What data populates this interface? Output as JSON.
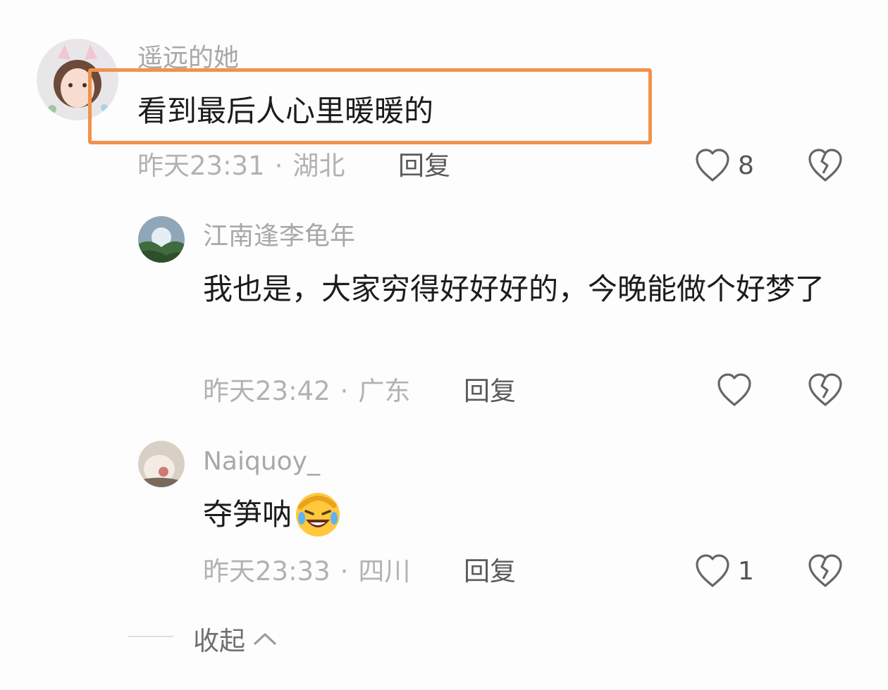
{
  "comments": [
    {
      "username": "遥远的她",
      "text": "看到最后人心里暖暖的",
      "time": "昨天23:31",
      "location": "湖北",
      "reply_label": "回复",
      "likes": "8"
    },
    {
      "username": "江南逢李龟年",
      "text": "我也是，大家穷得好好好的，今晚能做个好梦了",
      "time": "昨天23:42",
      "location": "广东",
      "reply_label": "回复",
      "likes": ""
    },
    {
      "username": "Naiquoy_",
      "text": "夺笋呐",
      "time": "昨天23:33",
      "location": "四川",
      "reply_label": "回复",
      "likes": "1"
    }
  ],
  "separator": "·",
  "collapse_label": "收起",
  "icons": {
    "like": "heart-outline-icon",
    "dislike": "broken-heart-icon",
    "emoji": "rofl-emoji-icon",
    "chevron": "chevron-up-icon"
  },
  "colors": {
    "highlight_border": "#f0924c",
    "text": "#1c1c1c",
    "muted": "#b2b2b2"
  }
}
